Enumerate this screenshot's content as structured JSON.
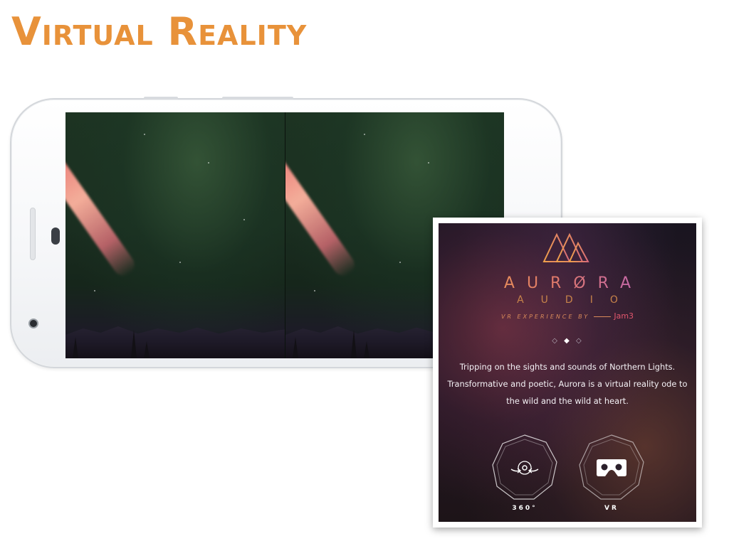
{
  "slide": {
    "title": "Virtual Reality"
  },
  "aurora_card": {
    "brand_name": "AURØRA",
    "brand_sub": "AUDIO",
    "credit_prefix": "VR EXPERIENCE BY",
    "credit_studio": "Jam3",
    "pager": [
      "◇",
      "◆",
      "◇"
    ],
    "description": "Tripping on the sights and sounds of Northern Lights. Transformative and poetic, Aurora is a virtual reality ode to the wild and the wild at heart.",
    "modes": [
      {
        "label": "360°",
        "icon": "rotate-360-icon"
      },
      {
        "label": "VR",
        "icon": "vr-headset-icon"
      }
    ]
  },
  "colors": {
    "title": "#e8923a",
    "brand_gradient_start": "#f0a24a",
    "brand_gradient_end": "#b25ad8",
    "jam3": "#e2566d"
  }
}
